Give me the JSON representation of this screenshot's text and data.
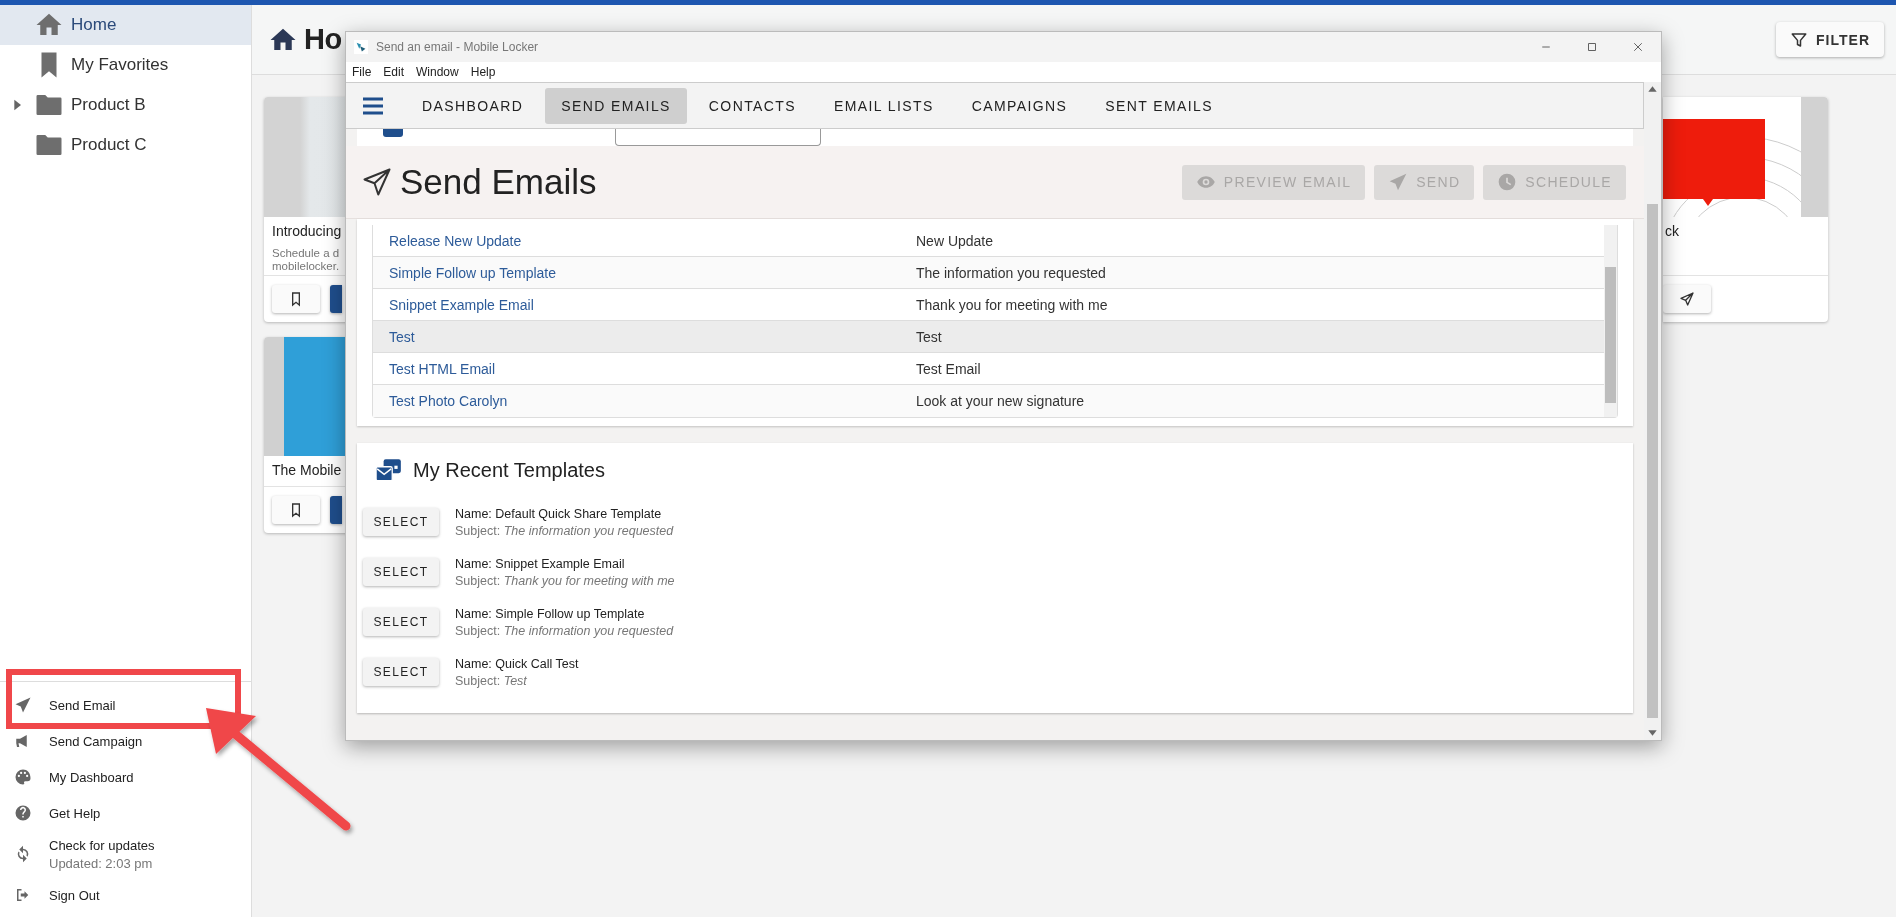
{
  "sidebar": {
    "items": [
      {
        "kind": "home",
        "label": "Home",
        "selected": true
      },
      {
        "kind": "bookmark",
        "label": "My Favorites",
        "selected": false
      },
      {
        "kind": "folder",
        "label": "Product B",
        "selected": false,
        "expanded": false
      },
      {
        "kind": "folder",
        "label": "Product C",
        "selected": false
      }
    ],
    "footer_items": [
      {
        "kind": "send",
        "label": "Send Email",
        "annotated": true
      },
      {
        "kind": "megaphone",
        "label": "Send Campaign",
        "annotated": false
      },
      {
        "kind": "palette",
        "label": "My Dashboard",
        "annotated": false
      },
      {
        "kind": "help",
        "label": "Get Help",
        "annotated": false
      },
      {
        "kind": "refresh",
        "label": "Check for updates",
        "sublabel": "Updated: 2:03 pm",
        "annotated": false
      },
      {
        "kind": "signout",
        "label": "Sign Out",
        "annotated": false
      }
    ]
  },
  "main": {
    "title": "Ho",
    "filter_button": "FILTER",
    "cards": [
      {
        "kind": "photo",
        "title": "Introducing",
        "description_lines": [
          "Schedule a d",
          "mobilelocker."
        ],
        "actions": [
          {
            "kind": "bookmark"
          },
          {
            "kind": "primary"
          }
        ]
      },
      {
        "kind": "slide",
        "title": "ck",
        "actions": [
          {
            "kind": "send"
          }
        ]
      },
      {
        "kind": "banner",
        "title": "The Mobile",
        "actions": [
          {
            "kind": "bookmark"
          },
          {
            "kind": "primary"
          }
        ]
      }
    ]
  },
  "window": {
    "title": "Send an email - Mobile Locker",
    "menu": [
      "File",
      "Edit",
      "Window",
      "Help"
    ],
    "tabs": [
      {
        "label": "DASHBOARD",
        "selected": false
      },
      {
        "label": "SEND EMAILS",
        "selected": true
      },
      {
        "label": "CONTACTS",
        "selected": false
      },
      {
        "label": "EMAIL LISTS",
        "selected": false
      },
      {
        "label": "CAMPAIGNS",
        "selected": false
      },
      {
        "label": "SENT EMAILS",
        "selected": false
      }
    ],
    "page_title": "Send Emails",
    "actions": [
      {
        "kind": "preview",
        "label": "PREVIEW EMAIL",
        "disabled": true
      },
      {
        "kind": "send",
        "label": "SEND",
        "disabled": true
      },
      {
        "kind": "schedule",
        "label": "SCHEDULE",
        "disabled": true
      }
    ],
    "templates_table": {
      "rows": [
        {
          "name": "Release New Update",
          "subject": "New Update",
          "selected": false
        },
        {
          "name": "Simple Follow up Template",
          "subject": "The information you requested",
          "selected": false
        },
        {
          "name": "Snippet Example Email",
          "subject": "Thank you for meeting with me",
          "selected": false
        },
        {
          "name": "Test",
          "subject": "Test",
          "selected": true
        },
        {
          "name": "Test HTML Email",
          "subject": "Test Email",
          "selected": false
        },
        {
          "name": "Test Photo Carolyn",
          "subject": "Look at your new signature",
          "selected": false
        }
      ]
    },
    "recent_templates": {
      "title": "My Recent Templates",
      "items": [
        {
          "button": "SELECT",
          "name": "Name: Default Quick Share Template",
          "subject": "Subject: *The information you requested*"
        },
        {
          "button": "SELECT",
          "name": "Name: Snippet Example Email",
          "subject": "Subject: *Thank you for meeting with me*"
        },
        {
          "button": "SELECT",
          "name": "Name: Simple Follow up Template",
          "subject": "Subject: *The information you requested*"
        },
        {
          "button": "SELECT",
          "name": "Name: Quick Call Test",
          "subject": "Subject: *Test*"
        }
      ]
    }
  }
}
